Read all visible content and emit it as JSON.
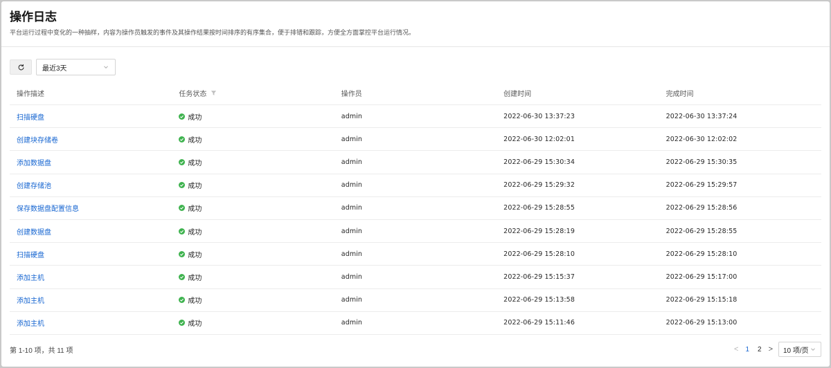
{
  "header": {
    "title": "操作日志",
    "description": "平台运行过程中变化的一种抽样，内容为操作员触发的事件及其操作结果按时间排序的有序集合，便于排错和跟踪，方便全方面掌控平台运行情况。"
  },
  "toolbar": {
    "refresh_icon": "refresh-icon",
    "time_range": "最近3天"
  },
  "table": {
    "columns": [
      "操作描述",
      "任务状态",
      "操作员",
      "创建时间",
      "完成时间"
    ],
    "rows": [
      {
        "desc": "扫描硬盘",
        "status": "成功",
        "operator": "admin",
        "created": "2022-06-30 13:37:23",
        "finished": "2022-06-30 13:37:24"
      },
      {
        "desc": "创建块存储卷",
        "status": "成功",
        "operator": "admin",
        "created": "2022-06-30 12:02:01",
        "finished": "2022-06-30 12:02:02"
      },
      {
        "desc": "添加数据盘",
        "status": "成功",
        "operator": "admin",
        "created": "2022-06-29 15:30:34",
        "finished": "2022-06-29 15:30:35"
      },
      {
        "desc": "创建存储池",
        "status": "成功",
        "operator": "admin",
        "created": "2022-06-29 15:29:32",
        "finished": "2022-06-29 15:29:57"
      },
      {
        "desc": "保存数据盘配置信息",
        "status": "成功",
        "operator": "admin",
        "created": "2022-06-29 15:28:55",
        "finished": "2022-06-29 15:28:56"
      },
      {
        "desc": "创建数据盘",
        "status": "成功",
        "operator": "admin",
        "created": "2022-06-29 15:28:19",
        "finished": "2022-06-29 15:28:55"
      },
      {
        "desc": "扫描硬盘",
        "status": "成功",
        "operator": "admin",
        "created": "2022-06-29 15:28:10",
        "finished": "2022-06-29 15:28:10"
      },
      {
        "desc": "添加主机",
        "status": "成功",
        "operator": "admin",
        "created": "2022-06-29 15:15:37",
        "finished": "2022-06-29 15:17:00"
      },
      {
        "desc": "添加主机",
        "status": "成功",
        "operator": "admin",
        "created": "2022-06-29 15:13:58",
        "finished": "2022-06-29 15:15:18"
      },
      {
        "desc": "添加主机",
        "status": "成功",
        "operator": "admin",
        "created": "2022-06-29 15:11:46",
        "finished": "2022-06-29 15:13:00"
      }
    ]
  },
  "footer": {
    "summary": "第 1-10 项，共 11 项",
    "prev": "<",
    "next": ">",
    "pages": [
      "1",
      "2"
    ],
    "current_page": "1",
    "page_size": "10 项/页"
  },
  "colors": {
    "link": "#1766d1",
    "success": "#3fb34f"
  }
}
